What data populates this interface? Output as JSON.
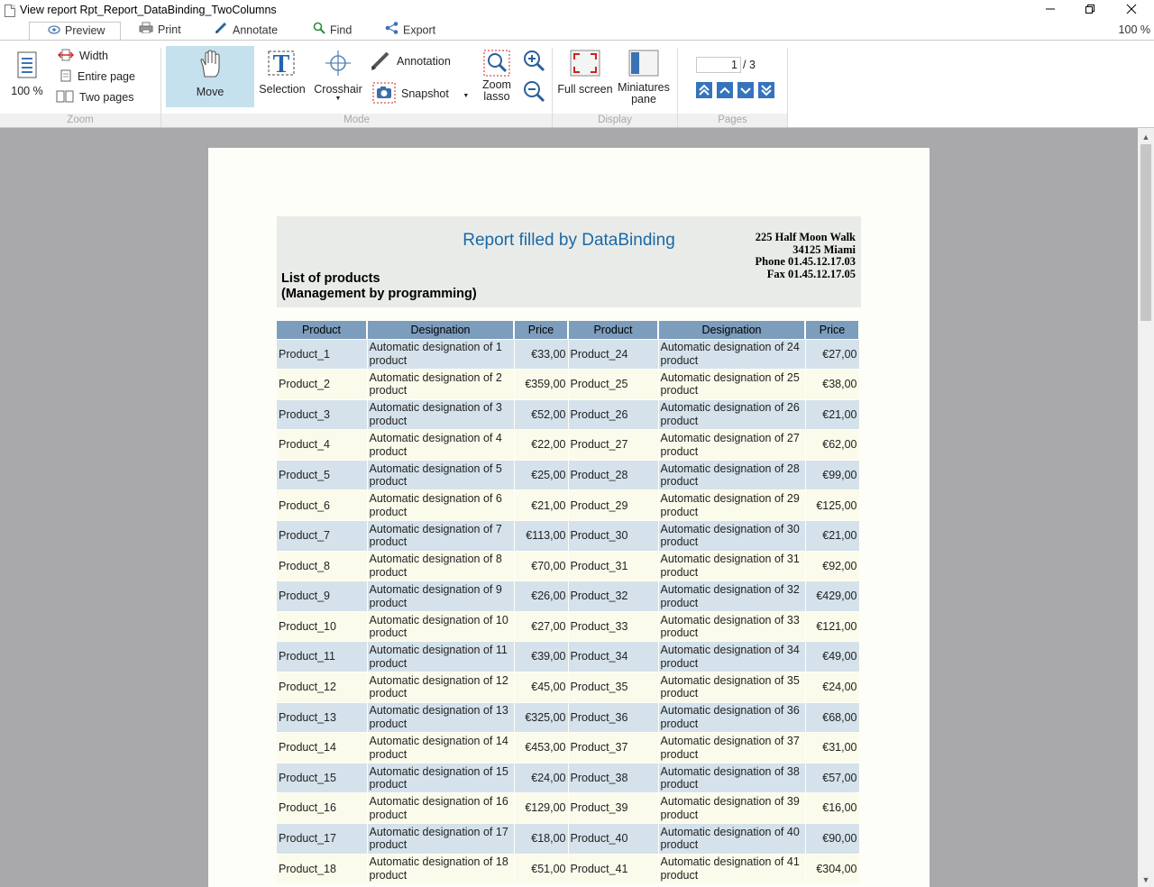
{
  "window": {
    "title": "View report Rpt_Report_DataBinding_TwoColumns"
  },
  "tabs": [
    {
      "label": "Preview"
    },
    {
      "label": "Print"
    },
    {
      "label": "Annotate"
    },
    {
      "label": "Find"
    },
    {
      "label": "Export"
    }
  ],
  "zoom_indicator": "100 %",
  "ribbon": {
    "zoom": {
      "label": "Zoom",
      "percent_label": "100 %",
      "width_label": "Width",
      "entire_page_label": "Entire page",
      "two_pages_label": "Two pages"
    },
    "mode": {
      "label": "Mode",
      "move_label": "Move",
      "selection_label": "Selection",
      "crosshair_label": "Crosshair",
      "annotation_label": "Annotation",
      "snapshot_label": "Snapshot",
      "zoom_lasso_line1": "Zoom",
      "zoom_lasso_line2": "lasso"
    },
    "display": {
      "label": "Display",
      "full_screen_label": "Full screen",
      "miniatures_line1": "Miniatures",
      "miniatures_line2": "pane"
    },
    "pages": {
      "label": "Pages",
      "current_page": "1",
      "total_pages": "/ 3"
    }
  },
  "report": {
    "title": "Report filled by DataBinding",
    "address": {
      "line1": "225 Half Moon Walk",
      "line2": "34125 Miami",
      "line3": "Phone 01.45.12.17.03",
      "line4": "Fax 01.45.12.17.05"
    },
    "subtitle_line1": "List of products",
    "subtitle_line2": "(Management by programming)",
    "columns": [
      "Product",
      "Designation",
      "Price",
      "Product",
      "Designation",
      "Price"
    ],
    "rows": [
      [
        "Product_1",
        "Automatic designation of 1 product",
        "€33,00",
        "Product_24",
        "Automatic designation of 24 product",
        "€27,00"
      ],
      [
        "Product_2",
        "Automatic designation of 2 product",
        "€359,00",
        "Product_25",
        "Automatic designation of 25 product",
        "€38,00"
      ],
      [
        "Product_3",
        "Automatic designation of 3 product",
        "€52,00",
        "Product_26",
        "Automatic designation of 26 product",
        "€21,00"
      ],
      [
        "Product_4",
        "Automatic designation of 4 product",
        "€22,00",
        "Product_27",
        "Automatic designation of 27 product",
        "€62,00"
      ],
      [
        "Product_5",
        "Automatic designation of 5 product",
        "€25,00",
        "Product_28",
        "Automatic designation of 28 product",
        "€99,00"
      ],
      [
        "Product_6",
        "Automatic designation of 6 product",
        "€21,00",
        "Product_29",
        "Automatic designation of 29 product",
        "€125,00"
      ],
      [
        "Product_7",
        "Automatic designation of 7 product",
        "€113,00",
        "Product_30",
        "Automatic designation of 30 product",
        "€21,00"
      ],
      [
        "Product_8",
        "Automatic designation of 8 product",
        "€70,00",
        "Product_31",
        "Automatic designation of 31 product",
        "€92,00"
      ],
      [
        "Product_9",
        "Automatic designation of 9 product",
        "€26,00",
        "Product_32",
        "Automatic designation of 32 product",
        "€429,00"
      ],
      [
        "Product_10",
        "Automatic designation of 10 product",
        "€27,00",
        "Product_33",
        "Automatic designation of 33 product",
        "€121,00"
      ],
      [
        "Product_11",
        "Automatic designation of 11 product",
        "€39,00",
        "Product_34",
        "Automatic designation of 34 product",
        "€49,00"
      ],
      [
        "Product_12",
        "Automatic designation of 12 product",
        "€45,00",
        "Product_35",
        "Automatic designation of 35 product",
        "€24,00"
      ],
      [
        "Product_13",
        "Automatic designation of 13 product",
        "€325,00",
        "Product_36",
        "Automatic designation of 36 product",
        "€68,00"
      ],
      [
        "Product_14",
        "Automatic designation of 14 product",
        "€453,00",
        "Product_37",
        "Automatic designation of 37 product",
        "€31,00"
      ],
      [
        "Product_15",
        "Automatic designation of 15 product",
        "€24,00",
        "Product_38",
        "Automatic designation of 38 product",
        "€57,00"
      ],
      [
        "Product_16",
        "Automatic designation of 16 product",
        "€129,00",
        "Product_39",
        "Automatic designation of 39 product",
        "€16,00"
      ],
      [
        "Product_17",
        "Automatic designation of 17 product",
        "€18,00",
        "Product_40",
        "Automatic designation of 40 product",
        "€90,00"
      ],
      [
        "Product_18",
        "Automatic designation of 18 product",
        "€51,00",
        "Product_41",
        "Automatic designation of 41 product",
        "€304,00"
      ]
    ]
  }
}
